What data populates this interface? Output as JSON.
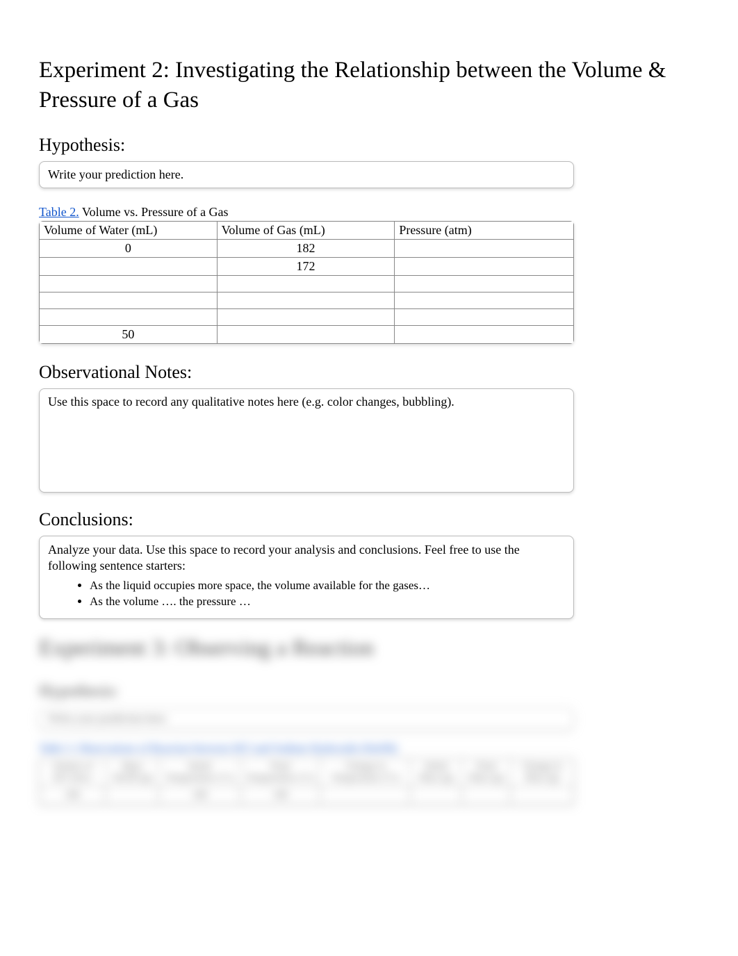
{
  "experiment2": {
    "title": "Experiment 2: Investigating the Relationship between the Volume & Pressure of a Gas",
    "hypothesis": {
      "heading": "Hypothesis:",
      "placeholder": "Write your prediction here."
    },
    "table": {
      "label": "Table 2.",
      "caption": "Volume vs. Pressure of a Gas",
      "headers": [
        "Volume of Water (mL)",
        "Volume of Gas (mL)",
        "Pressure (atm)"
      ],
      "rows": [
        {
          "water": "0",
          "gas": "182",
          "pressure": ""
        },
        {
          "water": "",
          "gas": "172",
          "pressure": ""
        },
        {
          "water": "",
          "gas": "",
          "pressure": ""
        },
        {
          "water": "",
          "gas": "",
          "pressure": ""
        },
        {
          "water": "",
          "gas": "",
          "pressure": ""
        },
        {
          "water": "50",
          "gas": "",
          "pressure": ""
        }
      ]
    },
    "observational": {
      "heading": "Observational Notes:",
      "placeholder": "Use this space to record any qualitative notes here (e.g. color changes, bubbling)."
    },
    "conclusions": {
      "heading": "Conclusions:",
      "intro": "Analyze your data. Use this space to record your analysis and conclusions. Feel free to use the following sentence starters:",
      "bullets": [
        "As the liquid occupies more space, the volume available for the gases…",
        "As the volume …. the pressure  …"
      ]
    }
  },
  "experiment3": {
    "title": "Experiment 3: Observing a Reaction",
    "hypothesis_heading": "Hypothesis:",
    "hypothesis_placeholder": "Write your prediction here.",
    "table_caption": "Table 3. Observations of Reaction between HCl and Sodium Hydroxide (NaOH)",
    "headers": [
      "Volume of HCl (mL)",
      "Mass NaOH (g)",
      "Initial Temperature (°C)",
      "Final Temperature (°C)",
      "Change in Temperature (°C)",
      "Initial Mass (g)",
      "Final Mass (g)",
      "Change in Mass (g)"
    ],
    "row": [
      "100",
      "",
      "100",
      "100",
      "",
      "",
      "",
      ""
    ]
  }
}
